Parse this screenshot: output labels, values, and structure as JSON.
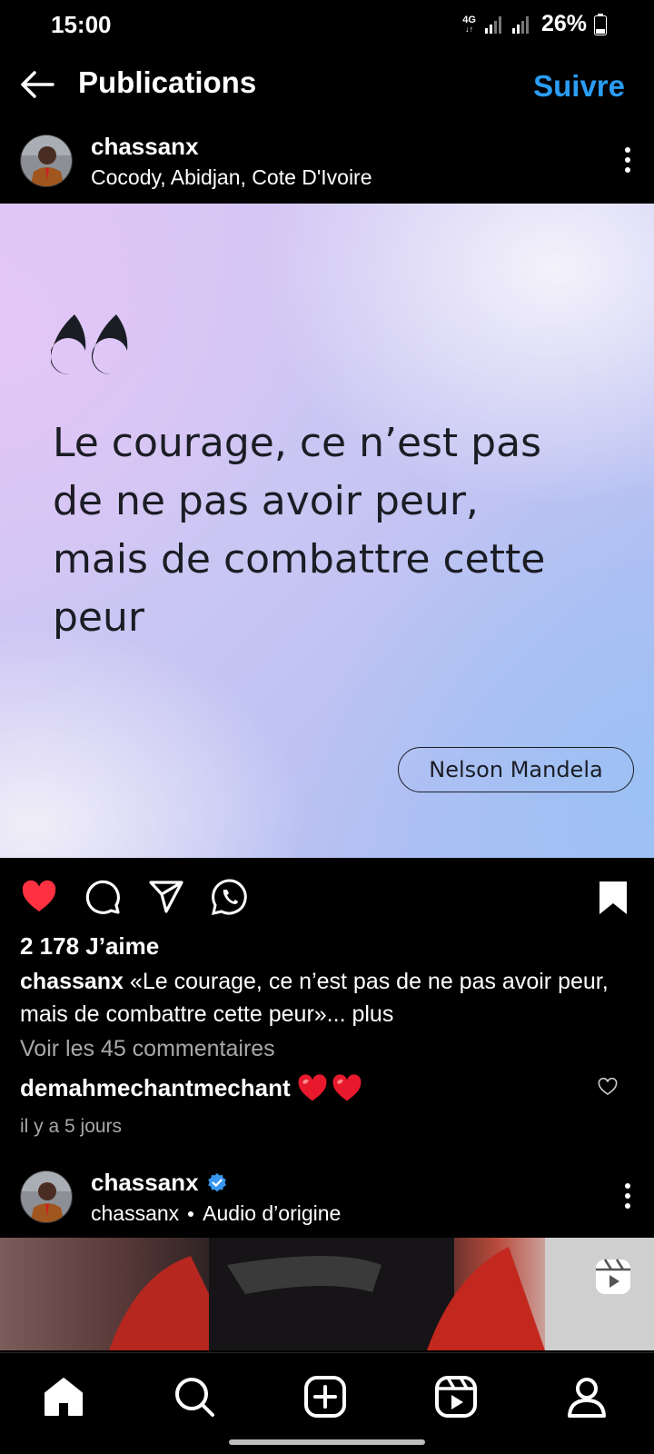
{
  "status_bar": {
    "time": "15:00",
    "network": "4G",
    "battery": "26%"
  },
  "header": {
    "title": "Publications",
    "follow_label": "Suivre"
  },
  "post": {
    "username": "chassanx",
    "location": "Cocody, Abidjan, Cote D'Ivoire",
    "quote_lines": [
      "Le courage, ce n’est pas",
      "de ne pas avoir peur,",
      "mais de combattre cette",
      "peur"
    ],
    "author": "Nelson Mandela",
    "likes": "2 178 J’aime",
    "caption_user": "chassanx",
    "caption_text": "«Le courage, ce n’est pas de ne pas avoir peur, mais de combattre cette peur»...",
    "caption_more": "plus",
    "view_comments": "Voir les 45 commentaires",
    "comment_user": "demahmechantmechant",
    "comment_text": "❤️❤️",
    "comment_time": "il y a 5 jours",
    "liked": true
  },
  "next_post": {
    "username": "chassanx",
    "verified": true,
    "sub_user": "chassanx",
    "audio": "Audio d’origine"
  },
  "colors": {
    "accent": "#2a9df4",
    "like": "#ff3040",
    "verified": "#3897f0"
  },
  "icons": {
    "actions": [
      "heart-icon",
      "comment-icon",
      "share-icon",
      "whatsapp-icon",
      "bookmark-icon"
    ],
    "nav": [
      "home-icon",
      "search-icon",
      "create-icon",
      "reels-icon",
      "profile-icon"
    ]
  }
}
